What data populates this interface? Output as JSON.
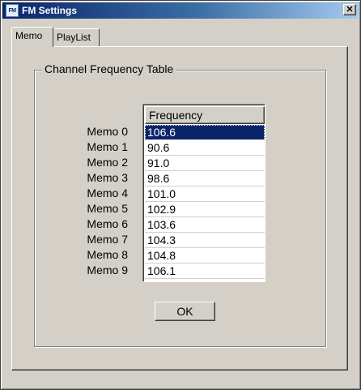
{
  "window": {
    "title": "FM Settings",
    "app_icon_text": "FM",
    "close_glyph": "✕"
  },
  "tabs": [
    {
      "label": "Memo",
      "active": true
    },
    {
      "label": "PlayList",
      "active": false
    }
  ],
  "group": {
    "title": "Channel Frequency Table"
  },
  "table": {
    "column_header": "Frequency",
    "row_labels": [
      "Memo 0",
      "Memo 1",
      "Memo 2",
      "Memo 3",
      "Memo 4",
      "Memo 5",
      "Memo 6",
      "Memo 7",
      "Memo 8",
      "Memo 9"
    ],
    "values": [
      "106.6",
      "90.6",
      "91.0",
      "98.6",
      "101.0",
      "102.9",
      "103.6",
      "104.3",
      "104.8",
      "106.1"
    ],
    "selected_index": 0
  },
  "buttons": {
    "ok_label": "OK"
  },
  "colors": {
    "face": "#d4d0c8",
    "selection": "#0a246a",
    "title_gradient_start": "#0a246a"
  }
}
